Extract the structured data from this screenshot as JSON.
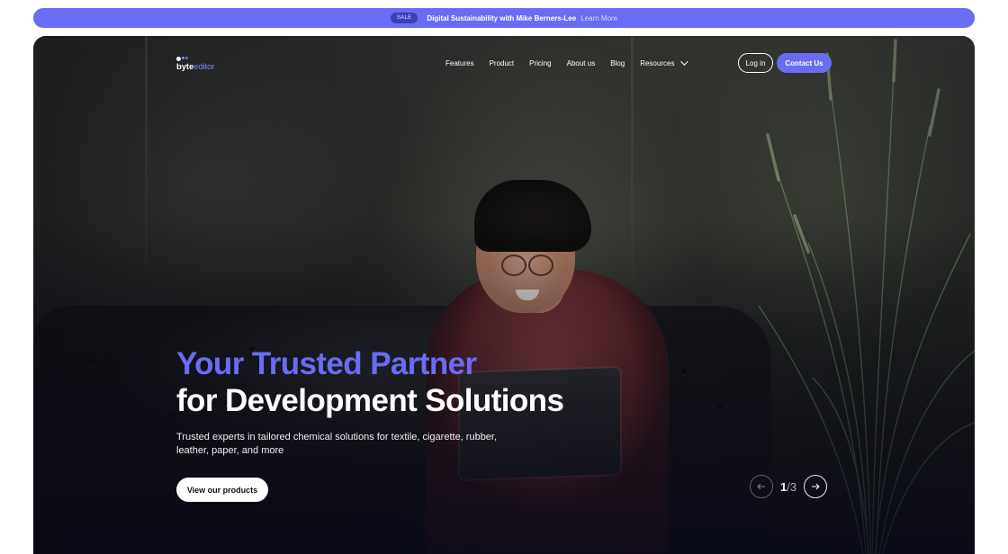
{
  "announcement": {
    "badge": "SALE",
    "text": "Digital Sustainability with Mike Berners-Lee",
    "link": "Learn More"
  },
  "brand": {
    "logo_main": "byte",
    "logo_accent": "editor",
    "accent_color": "#6a6cf5"
  },
  "nav": {
    "items": [
      "Features",
      "Product",
      "Pricing",
      "About us",
      "Blog",
      "Resources"
    ],
    "login": "Log in",
    "contact": "Contact Us"
  },
  "hero": {
    "title_line1": "Your Trusted Partner",
    "title_line2": "for Development Solutions",
    "subtitle": "Trusted experts in tailored chemical solutions for textile, cigarette, rubber, leather, paper, and more",
    "cta": "View our products"
  },
  "slider": {
    "current": "1",
    "separator": "/",
    "total": "3",
    "prev_icon": "arrow-left-icon",
    "next_icon": "arrow-right-icon"
  }
}
